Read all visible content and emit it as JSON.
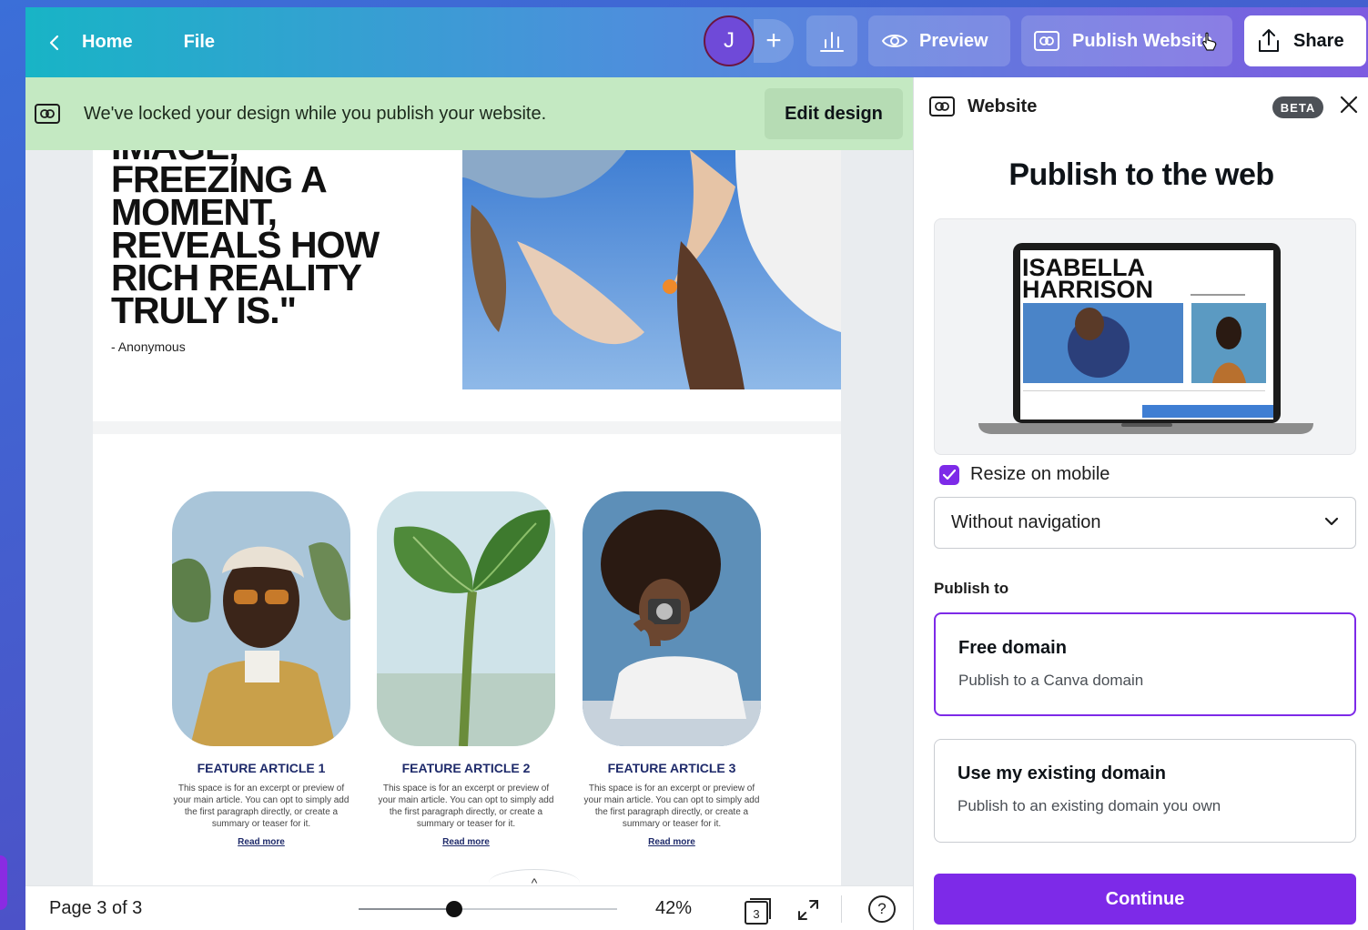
{
  "topbar": {
    "home_label": "Home",
    "file_label": "File",
    "avatar_initial": "J",
    "add_label": "+",
    "preview_label": "Preview",
    "publish_label": "Publish Website",
    "share_label": "Share"
  },
  "banner": {
    "message": "We've locked your design while you publish your website.",
    "edit_label": "Edit design"
  },
  "page": {
    "quote_lines": [
      "IMAGE,",
      "FREEZING A",
      "MOMENT,",
      "REVEALS HOW",
      "RICH REALITY",
      "TRULY IS.\""
    ],
    "quote_author": "- Anonymous",
    "cards": [
      {
        "title": "FEATURE ARTICLE 1",
        "body": "This space is for an excerpt or preview of your main article. You can opt to simply add the first paragraph directly, or create a summary or teaser for it.",
        "read_more": "Read more"
      },
      {
        "title": "FEATURE ARTICLE 2",
        "body": "This space is for an excerpt or preview of your main article. You can opt to simply add the first paragraph directly, or create a summary or teaser for it.",
        "read_more": "Read more"
      },
      {
        "title": "FEATURE ARTICLE 3",
        "body": "This space is for an excerpt or preview of your main article. You can opt to simply add the first paragraph directly, or create a summary or teaser for it.",
        "read_more": "Read more"
      }
    ],
    "collapse_glyph": "^"
  },
  "statusbar": {
    "page_label": "Page 3 of 3",
    "zoom_percent": 42,
    "zoom_label": "42%",
    "zoom_slider_fraction": 0.37,
    "page_count_badge": "3",
    "help_glyph": "?"
  },
  "panel": {
    "header_title": "Website",
    "beta_label": "BETA",
    "title": "Publish to the web",
    "preview_site_name_line1": "ISABELLA",
    "preview_site_name_line2": "HARRISON",
    "resize_label": "Resize on mobile",
    "resize_checked": true,
    "navigation_value": "Without navigation",
    "publish_to_label": "Publish to",
    "options": [
      {
        "title": "Free domain",
        "subtitle": "Publish to a Canva domain",
        "selected": true
      },
      {
        "title": "Use my existing domain",
        "subtitle": "Publish to an existing domain you own",
        "selected": false
      }
    ],
    "continue_label": "Continue"
  },
  "colors": {
    "accent": "#7d2ae8",
    "banner_bg": "#c4e9c2",
    "topbar_start": "#18b4c6",
    "topbar_end": "#7d5ce0",
    "card_title": "#1e2a6a"
  }
}
